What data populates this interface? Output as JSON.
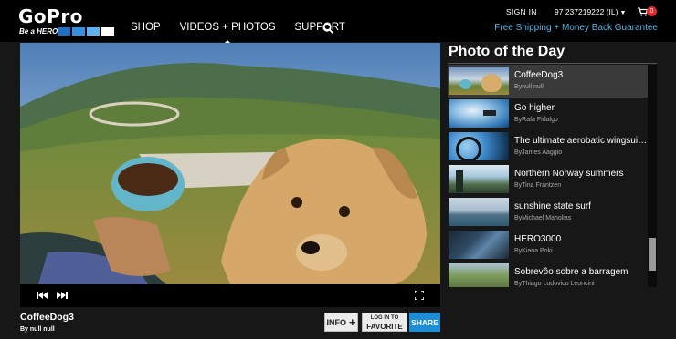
{
  "header": {
    "logo_text": "GoPro",
    "logo_tagline": "Be a HERO.",
    "nav": [
      {
        "label": "SHOP"
      },
      {
        "label": "VIDEOS + PHOTOS"
      },
      {
        "label": "SUPPORT"
      }
    ],
    "signin_label": "SIGN IN",
    "phone": "97 237219222 (IL)",
    "cart_count": "0",
    "promo": "Free Shipping + Money Back Guarantee"
  },
  "player": {
    "title": "CoffeeDog3",
    "byline": "By null null"
  },
  "actions": {
    "info_label": "INFO",
    "favorite_line1": "LOG IN TO",
    "favorite_line2": "FAVORITE",
    "share_label": "SHARE"
  },
  "potd": {
    "heading": "Photo of the Day",
    "items": [
      {
        "title": "CoffeeDog3",
        "byline": "Bynull null"
      },
      {
        "title": "Go higher",
        "byline": "ByRafa Fidalgo"
      },
      {
        "title": "The ultimate aerobatic wingsuit video",
        "byline": "ByJames Aaggio"
      },
      {
        "title": "Northern Norway summers",
        "byline": "ByTina Frantzen"
      },
      {
        "title": "sunshine state surf",
        "byline": "ByMichael Maholias"
      },
      {
        "title": "HERO3000",
        "byline": "ByKiana Poki"
      },
      {
        "title": "Sobrevôo sobre a barragem",
        "byline": "ByThiago Ludovico Leoncini"
      }
    ]
  },
  "colors": {
    "accent_blue": "#1d8ed5",
    "promo_blue": "#59b4e6",
    "cart_badge": "#e4282b",
    "logo_squares": [
      "#1f6fc2",
      "#3591e0",
      "#5fb0ef",
      "#ffffff"
    ]
  },
  "icons": [
    "search-icon",
    "cart-icon",
    "skip-back-icon",
    "skip-forward-icon",
    "fullscreen-icon",
    "plus-icon",
    "caret-down-icon"
  ]
}
